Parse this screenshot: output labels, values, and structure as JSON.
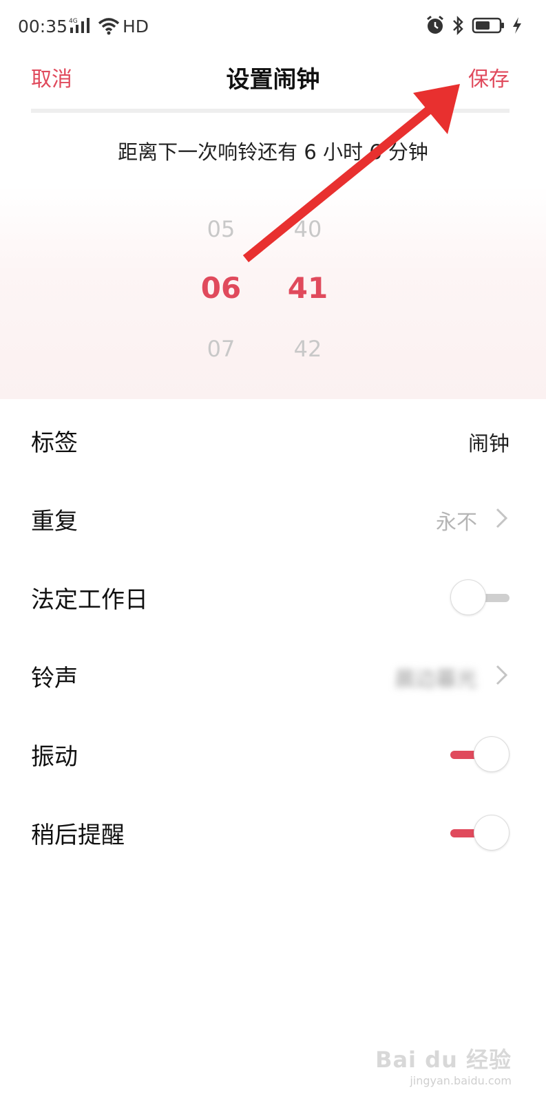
{
  "status": {
    "time": "00:35",
    "network_badge": "4G",
    "hd": "HD"
  },
  "header": {
    "cancel": "取消",
    "title": "设置闹钟",
    "save": "保存"
  },
  "countdown": "距离下一次响铃还有  6 小时 6 分钟",
  "picker": {
    "hour_prev": "05",
    "hour_selected": "06",
    "hour_next": "07",
    "minute_prev": "40",
    "minute_selected": "41",
    "minute_next": "42"
  },
  "settings": {
    "label": {
      "title": "标签",
      "value": "闹钟"
    },
    "repeat": {
      "title": "重复",
      "value": "永不"
    },
    "workday": {
      "title": "法定工作日",
      "enabled": false
    },
    "ringtone": {
      "title": "铃声",
      "value": "晨边暮光"
    },
    "vibrate": {
      "title": "振动",
      "enabled": true
    },
    "snooze": {
      "title": "稍后提醒",
      "enabled": true
    }
  },
  "watermark": {
    "logo": "Bai du 经验",
    "url": "jingyan.baidu.com"
  },
  "colors": {
    "accent": "#e04a5c",
    "arrow": "#e8302f"
  }
}
